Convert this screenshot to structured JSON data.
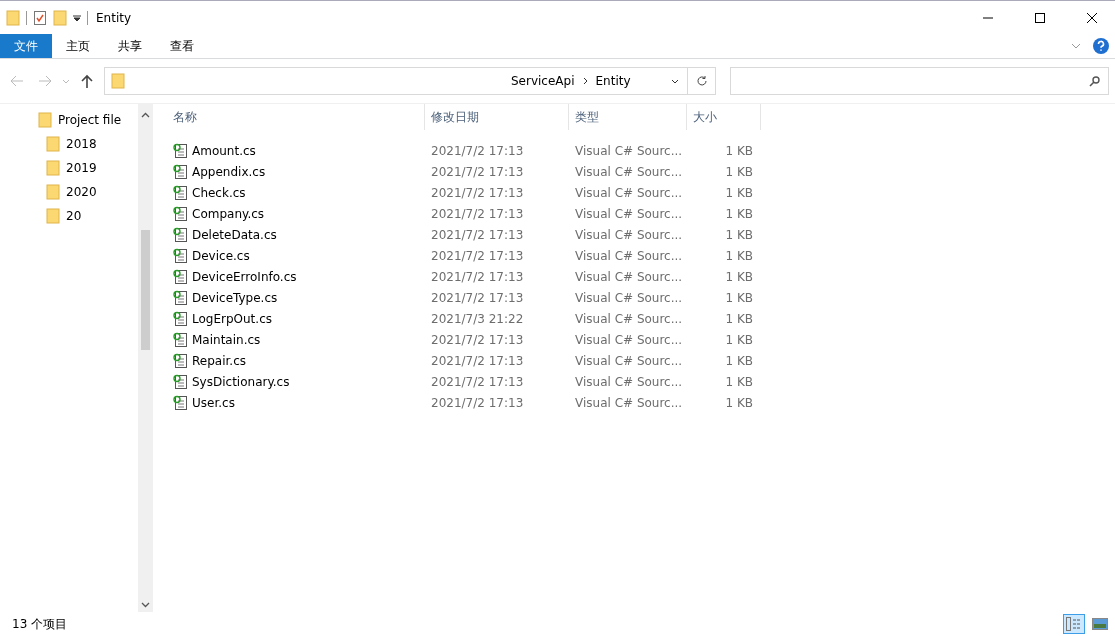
{
  "window": {
    "title": "Entity"
  },
  "ribbon_tabs": [
    {
      "label": "文件",
      "selected": true
    },
    {
      "label": "主页",
      "selected": false
    },
    {
      "label": "共享",
      "selected": false
    },
    {
      "label": "查看",
      "selected": false
    }
  ],
  "address": {
    "path": [
      "ServiceApi",
      "Entity"
    ]
  },
  "navigation": {
    "items": [
      {
        "label": "Project file",
        "children": [
          {
            "label": "2018"
          },
          {
            "label": "2019"
          },
          {
            "label": "2020"
          },
          {
            "label": "20"
          }
        ]
      }
    ]
  },
  "table": {
    "columns": [
      "名称",
      "修改日期",
      "类型",
      "大小"
    ],
    "rows": [
      {
        "name": "Amount.cs",
        "modified": "2021/7/2 17:13",
        "type": "Visual C# Sourc...",
        "size": "1 KB"
      },
      {
        "name": "Appendix.cs",
        "modified": "2021/7/2 17:13",
        "type": "Visual C# Sourc...",
        "size": "1 KB"
      },
      {
        "name": "Check.cs",
        "modified": "2021/7/2 17:13",
        "type": "Visual C# Sourc...",
        "size": "1 KB"
      },
      {
        "name": "Company.cs",
        "modified": "2021/7/2 17:13",
        "type": "Visual C# Sourc...",
        "size": "1 KB"
      },
      {
        "name": "DeleteData.cs",
        "modified": "2021/7/2 17:13",
        "type": "Visual C# Sourc...",
        "size": "1 KB"
      },
      {
        "name": "Device.cs",
        "modified": "2021/7/2 17:13",
        "type": "Visual C# Sourc...",
        "size": "1 KB"
      },
      {
        "name": "DeviceErroInfo.cs",
        "modified": "2021/7/2 17:13",
        "type": "Visual C# Sourc...",
        "size": "1 KB"
      },
      {
        "name": "DeviceType.cs",
        "modified": "2021/7/2 17:13",
        "type": "Visual C# Sourc...",
        "size": "1 KB"
      },
      {
        "name": "LogErpOut.cs",
        "modified": "2021/7/3 21:22",
        "type": "Visual C# Sourc...",
        "size": "1 KB"
      },
      {
        "name": "Maintain.cs",
        "modified": "2021/7/2 17:13",
        "type": "Visual C# Sourc...",
        "size": "1 KB"
      },
      {
        "name": "Repair.cs",
        "modified": "2021/7/2 17:13",
        "type": "Visual C# Sourc...",
        "size": "1 KB"
      },
      {
        "name": "SysDictionary.cs",
        "modified": "2021/7/2 17:13",
        "type": "Visual C# Sourc...",
        "size": "1 KB"
      },
      {
        "name": "User.cs",
        "modified": "2021/7/2 17:13",
        "type": "Visual C# Sourc...",
        "size": "1 KB"
      }
    ]
  },
  "status_bar": {
    "text": "13 个项目",
    "view_details_selected": true
  }
}
